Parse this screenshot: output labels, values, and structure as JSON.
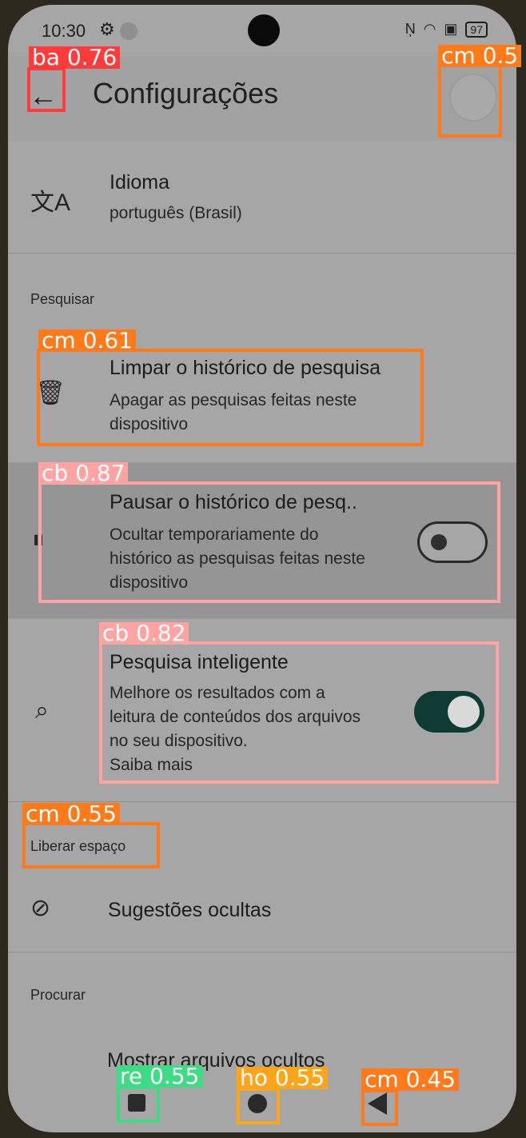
{
  "status_bar": {
    "time": "10:30",
    "battery": "97"
  },
  "app_bar": {
    "title": "Configurações"
  },
  "language": {
    "title": "Idioma",
    "value": "português (Brasil)"
  },
  "search_section": {
    "label": "Pesquisar"
  },
  "clear_history": {
    "title": "Limpar o histórico de pesquisa",
    "subtitle": "Apagar as pesquisas feitas neste dispositivo"
  },
  "pause_history": {
    "title": "Pausar o histórico de pesq..",
    "subtitle": "Ocultar temporariamente do histórico as pesquisas feitas neste dispositivo",
    "enabled": false
  },
  "smart_search": {
    "title": "Pesquisa inteligente",
    "subtitle": "Melhore os resultados com a leitura de conteúdos dos arquivos no seu dispositivo.",
    "link": "Saiba mais",
    "enabled": true
  },
  "free_space_section": {
    "label": "Liberar espaço"
  },
  "hidden_suggestions": {
    "title": "Sugestões ocultas"
  },
  "browse_section": {
    "label": "Procurar"
  },
  "show_hidden_files": {
    "title": "Mostrar arquivos ocultos"
  },
  "icons": [
    "arrow-back-icon",
    "translate-icon",
    "trash-icon",
    "pause-circle-icon",
    "smart-search-icon",
    "eye-off-icon"
  ],
  "detections": [
    {
      "label": "ba 0.76",
      "color": "#ff3b3b"
    },
    {
      "label": "cm 0.5",
      "color": "#ff7a1a"
    },
    {
      "label": "cm 0.61",
      "color": "#ff7a1a"
    },
    {
      "label": "cb 0.87",
      "color": "#ffa3a3"
    },
    {
      "label": "cb 0.82",
      "color": "#ffa3a3"
    },
    {
      "label": "cm 0.55",
      "color": "#ff7a1a"
    },
    {
      "label": "re 0.55",
      "color": "#3ddc84"
    },
    {
      "label": "ho 0.55",
      "color": "#ffa51a"
    },
    {
      "label": "cm 0.45",
      "color": "#ff7a1a"
    }
  ]
}
